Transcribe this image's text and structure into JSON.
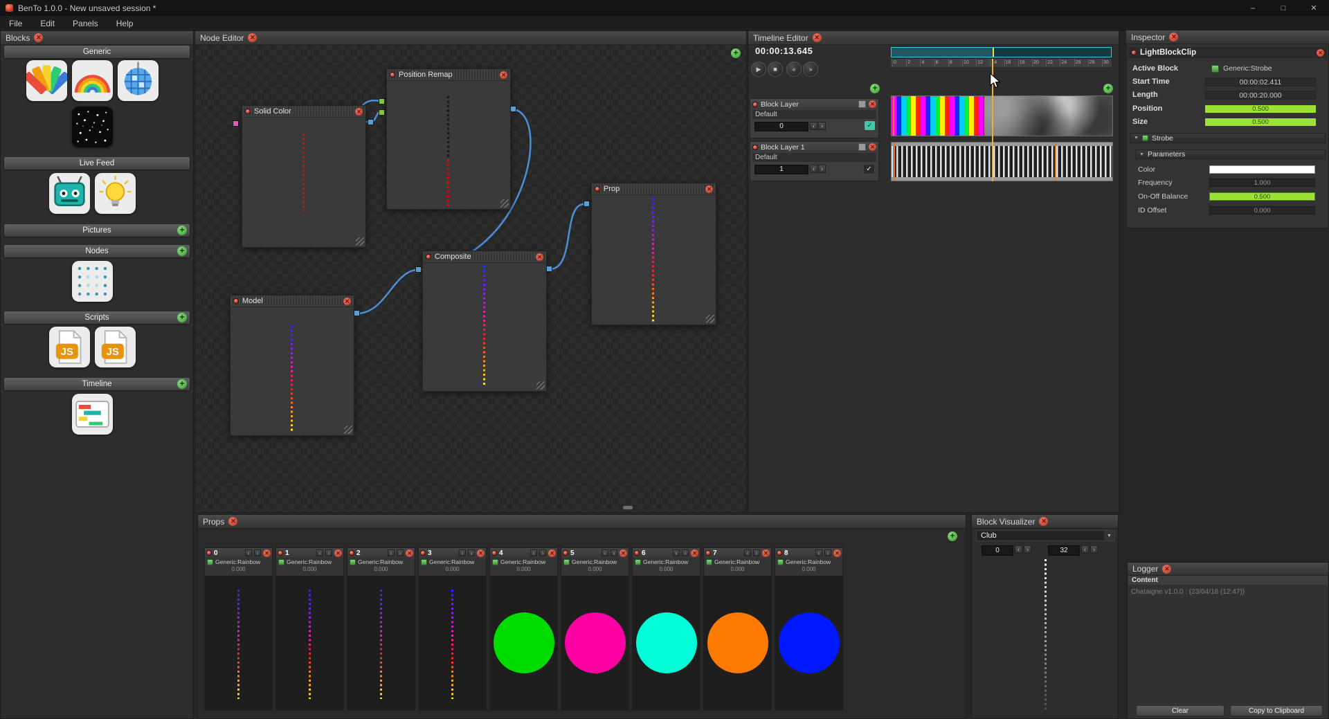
{
  "icons": {
    "close": "✕",
    "add": "+",
    "check": "✓",
    "minimize": "–",
    "maximize": "□",
    "play": "▶",
    "stop": "■",
    "prev": "«",
    "next": "»",
    "step_left": "‹",
    "step_right": "›",
    "dropdown": "▼",
    "collapse": "▼"
  },
  "colors": {
    "accent-red": "#cd4f3d",
    "led-red": "#d23b2d",
    "accent-green": "#56b54c",
    "wire-blue": "#4a90d9",
    "port-blue": "#5a9fd4",
    "port-green": "#84c440",
    "port-pink": "#e255c5",
    "slider-green": "#9be234",
    "check-teal": "#3ec9a7",
    "playhead": "#f5a93a",
    "clip-marker": "#e07820",
    "overview-teal": "#3fc8dc"
  },
  "titlebar": {
    "title": "BenTo 1.0.0 - New unsaved session *"
  },
  "menubar": {
    "items": [
      "File",
      "Edit",
      "Panels",
      "Help"
    ]
  },
  "blocks_panel": {
    "title": "Blocks",
    "sections": [
      {
        "label": "Generic"
      },
      {
        "label": "Live Feed"
      },
      {
        "label": "Pictures"
      },
      {
        "label": "Nodes"
      },
      {
        "label": "Scripts"
      },
      {
        "label": "Timeline"
      }
    ]
  },
  "node_editor": {
    "title": "Node Editor",
    "nodes": [
      {
        "title": "Solid Color"
      },
      {
        "title": "Position Remap"
      },
      {
        "title": "Model"
      },
      {
        "title": "Composite"
      },
      {
        "title": "Prop"
      }
    ]
  },
  "lines": {
    "solid": [
      [
        "#cc1111",
        "0%"
      ],
      [
        "#cc1111",
        "100%"
      ]
    ],
    "remap": [
      [
        "#161616",
        "0%"
      ],
      [
        "#161616",
        "56%"
      ],
      [
        "#cc1111",
        "56%"
      ],
      [
        "#cc1111",
        "100%"
      ]
    ],
    "rainbow": [
      [
        "#2a2aff",
        "0%"
      ],
      [
        "#8a22ee",
        "22%"
      ],
      [
        "#ee22aa",
        "42%"
      ],
      [
        "#ee2222",
        "60%"
      ],
      [
        "#ff8822",
        "78%"
      ],
      [
        "#ffee22",
        "100%"
      ]
    ],
    "fade": [
      [
        "#f2f2f2",
        "0%"
      ],
      [
        "#cccccc",
        "30%"
      ],
      [
        "#8a8a8a",
        "65%"
      ],
      [
        "#4a4a4a",
        "100%"
      ]
    ]
  },
  "timeline_editor": {
    "title": "Timeline Editor",
    "time": "00:00:13.645",
    "layers": [
      {
        "name": "Block Layer",
        "target": "Default",
        "value": "0"
      },
      {
        "name": "Block Layer 1",
        "target": "Default",
        "value": "1"
      }
    ],
    "ruler": {
      "start": 0,
      "end": 30,
      "step": 2
    }
  },
  "inspector": {
    "title": "Inspector",
    "clip_name": "LightBlockClip",
    "rows": [
      {
        "label": "Active Block",
        "value": "Generic:Strobe"
      },
      {
        "label": "Start Time",
        "value": "00:00:02.411"
      },
      {
        "label": "Length",
        "value": "00:00:20.000"
      },
      {
        "label": "Position",
        "value": "0.500"
      },
      {
        "label": "Size",
        "value": "0.500"
      }
    ],
    "section": "Strobe",
    "subsection": "Parameters",
    "params": [
      {
        "label": "Color"
      },
      {
        "label": "Frequency",
        "value": "1.000"
      },
      {
        "label": "On-Off Balance",
        "value": "0.500"
      },
      {
        "label": "ID Offset",
        "value": "0.000"
      }
    ]
  },
  "props_panel": {
    "title": "Props",
    "props": [
      {
        "index": "0",
        "type": "Generic:Rainbow",
        "value": "0.000"
      },
      {
        "index": "1",
        "type": "Generic:Rainbow",
        "value": "0.000"
      },
      {
        "index": "2",
        "type": "Generic:Rainbow",
        "value": "0.000"
      },
      {
        "index": "3",
        "type": "Generic:Rainbow",
        "value": "0.000"
      },
      {
        "index": "4",
        "type": "Generic:Rainbow",
        "value": "0.000",
        "color": "#00dc00"
      },
      {
        "index": "5",
        "type": "Generic:Rainbow",
        "value": "0.000",
        "color": "#ff00a2"
      },
      {
        "index": "6",
        "type": "Generic:Rainbow",
        "value": "0.000",
        "color": "#00ffd8"
      },
      {
        "index": "7",
        "type": "Generic:Rainbow",
        "value": "0.000",
        "color": "#ff7a00"
      },
      {
        "index": "8",
        "type": "Generic:Rainbow",
        "value": "0.000",
        "color": "#0018ff"
      }
    ]
  },
  "block_visualizer": {
    "title": "Block Visualizer",
    "selected": "Club",
    "range_min": "0",
    "range_max": "32"
  },
  "logger": {
    "title": "Logger",
    "content_label": "Content",
    "log_line": "Chataigne v1.0.0 : (23/04/18 (12:47))",
    "clear_label": "Clear",
    "copy_label": "Copy to Clipboard"
  }
}
